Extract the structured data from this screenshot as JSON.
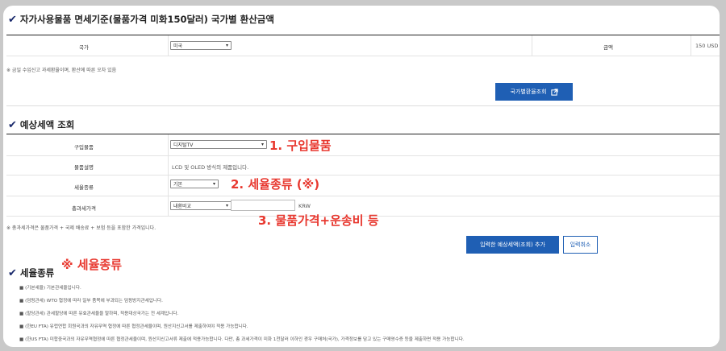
{
  "section1": {
    "title": "자가사용물품 면세기준(물품가격 미화150달러) 국가별 환산금액",
    "country_label": "국가",
    "country_value": "미국",
    "amount_label": "금액",
    "amount_value": "150 USD",
    "note": "※ 금일 수입신고 과세환율이며, 환산에 따른 오차 있음",
    "lookup_button": "국가별환율조회"
  },
  "section2": {
    "title": "예상세액 조회",
    "rows": [
      {
        "label": "구입물품",
        "value": "디지털TV"
      },
      {
        "label": "물품설명",
        "value": "LCD 및 OLED 방식의 제품입니다."
      },
      {
        "label": "세율종류",
        "value": "기본"
      },
      {
        "label": "총과세가격",
        "currency_select": "내환비교",
        "unit": "KRW"
      }
    ],
    "note": "※ 총과세가격은 물품가격 + 국제 배송료 + 보험 등을 포함한 가격입니다.",
    "calc_button": "입력한 예상세액(조회) 추가",
    "cancel_button": "입력취소"
  },
  "annotations": {
    "a1": "1. 구입물품",
    "a2": "2. 세율종류 (※)",
    "a3": "3. 물품가격+운송비 등",
    "a4": "※ 세율종류"
  },
  "section3": {
    "title": "세율종류",
    "bullets": [
      "■ (기본세율) 기본관세율입니다.",
      "■ (덤핑관세) WTO 협정에 따라 일부 품목에 부과되는 덤핑방지관세입니다.",
      "■ (할당관세) 관세할당에 따른 유효관세율을 말하며, 적용대상국가는 전 세계입니다.",
      "■ (한EU FTA) 유럽연합 회원국과의 자유무역 협정에 따른 협정관세율이며, 원산지신고서를 제출하여야 적용 가능합니다.",
      "■ (한US FTA) 미합중국과의 자유무역협정에 따른 협정관세율이며, 원산지신고서류 제출에 적용가능합니다. 다만, 총 과세가격이 미화 1천달러 이하인 경우 구매처(국가), 가격정보를 담고 있는 구매영수증 등을 제출하면 적용 가능합니다."
    ]
  }
}
